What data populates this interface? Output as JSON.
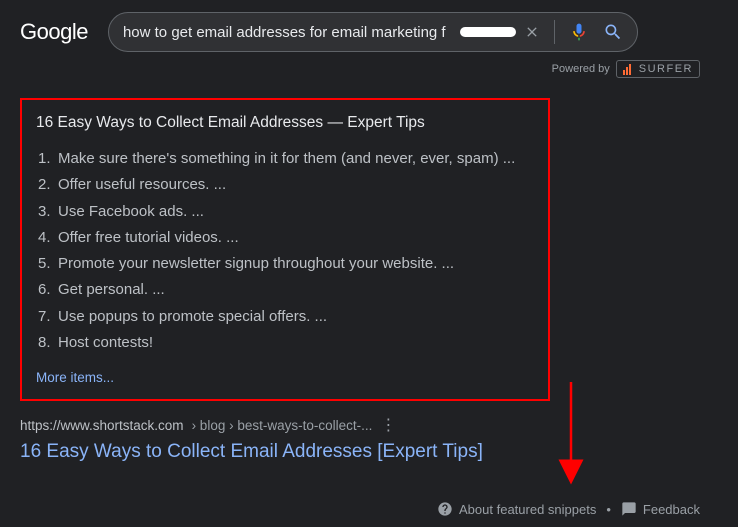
{
  "header": {
    "logo": "Google",
    "search_value": "how to get email addresses for email marketing f",
    "powered_by": "Powered by",
    "surfer": "SURFER"
  },
  "snippet": {
    "title": "16 Easy Ways to Collect Email Addresses — Expert Tips",
    "items": [
      "Make sure there's something in it for them (and never, ever, spam) ...",
      "Offer useful resources. ...",
      "Use Facebook ads. ...",
      "Offer free tutorial videos. ...",
      "Promote your newsletter signup throughout your website. ...",
      "Get personal. ...",
      "Use popups to promote special offers. ...",
      "Host contests!"
    ],
    "more": "More items..."
  },
  "result": {
    "domain": "https://www.shortstack.com",
    "crumbs": " › blog › best-ways-to-collect-...",
    "title": "16 Easy Ways to Collect Email Addresses [Expert Tips]"
  },
  "footer": {
    "about": "About featured snippets",
    "sep": "•",
    "feedback": "Feedback"
  }
}
